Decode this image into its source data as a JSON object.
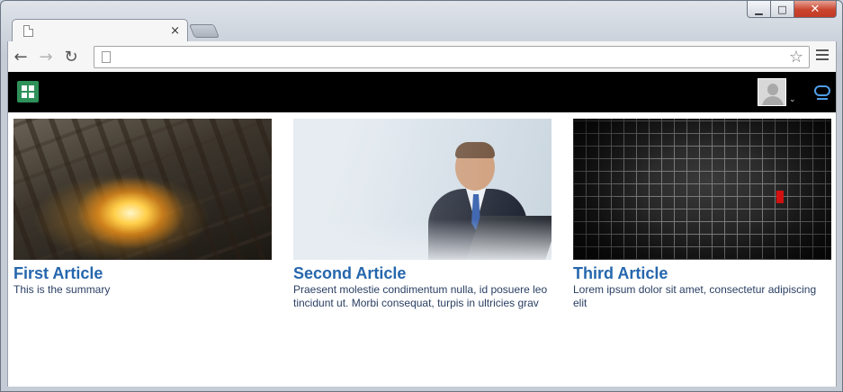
{
  "window": {
    "minimize_glyph": "▁",
    "maximize_glyph": "□",
    "close_glyph": "✕"
  },
  "browser": {
    "tab": {
      "title": "",
      "close_glyph": "×",
      "icon": "page-icon"
    },
    "toolbar": {
      "back_glyph": "←",
      "forward_glyph": "→",
      "reload_glyph": "↻",
      "address_value": "",
      "bookmark_glyph": "☆",
      "menu_icon": "hamburger-menu-icon"
    }
  },
  "app": {
    "header_background": "#000000",
    "logo_color": "#2e9159",
    "logo_icon": "grid-logo-icon",
    "avatar_icon": "user-avatar-icon",
    "avatar_caret": "⌄",
    "signout_icon": "signout-icon",
    "accent_color": "#4f9ee8"
  },
  "articles": [
    {
      "title": "First Article",
      "summary": "This is the summary",
      "image": "factory-sparks-image"
    },
    {
      "title": "Second Article",
      "summary": "Praesent molestie condimentum nulla, id posuere leo tincidunt ut. Morbi consequat, turpis in ultricies grav",
      "image": "businessman-image"
    },
    {
      "title": "Third Article",
      "summary": "Lorem ipsum dolor sit amet, consectetur adipiscing elit",
      "image": "dark-grid-image"
    }
  ],
  "colors": {
    "article_title": "#2566ad",
    "article_summary": "#2a3f63"
  }
}
